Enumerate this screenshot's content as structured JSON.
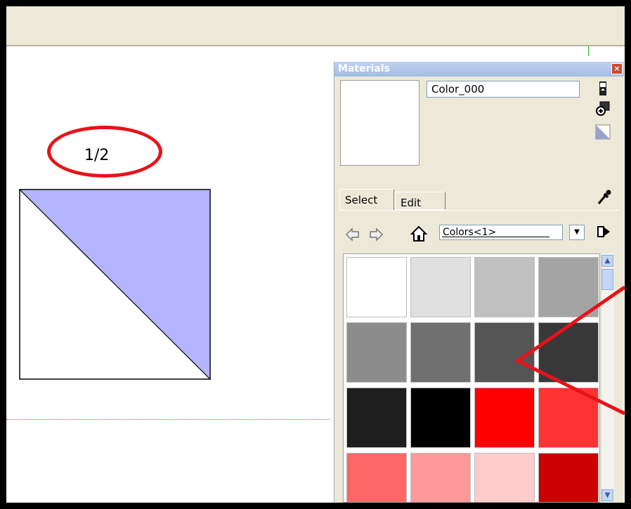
{
  "canvas": {
    "fraction_label": "1/2",
    "colors": {
      "triangle_fill": "#b4b4ff",
      "annotation_red": "#e8121a",
      "topbar": "#ece9d8"
    }
  },
  "materials_panel": {
    "title": "Materials",
    "close_icon": "close-icon",
    "material_name": "Color_000",
    "tabs": [
      {
        "label": "Select",
        "active": true
      },
      {
        "label": "Edit",
        "active": false
      }
    ],
    "collection": "Colors<1>",
    "icons": {
      "display_toggle": "display-toggle-icon",
      "create_material": "create-material-icon",
      "default_material": "default-material-icon",
      "eyedropper": "eyedropper-icon",
      "back": "back-arrow-icon",
      "forward": "forward-arrow-icon",
      "home": "home-icon",
      "details": "details-arrow-icon"
    },
    "swatches": [
      "#ffffff",
      "#e0e0e0",
      "#c0c0c0",
      "#a4a4a4",
      "#8c8c8c",
      "#707070",
      "#555555",
      "#383838",
      "#1e1e1e",
      "#000000",
      "#ff0000",
      "#ff3333",
      "#ff6666",
      "#ff9999",
      "#ffcccc",
      "#cc0000"
    ]
  }
}
